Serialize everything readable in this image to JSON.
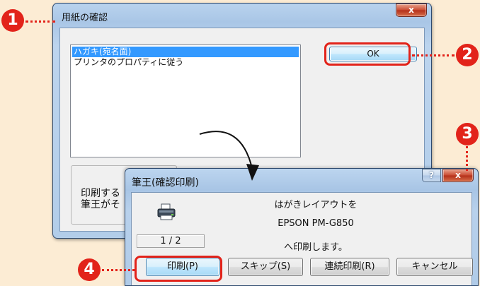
{
  "callouts": [
    "1",
    "2",
    "3",
    "4"
  ],
  "dialog_confirm_paper": {
    "title": "用紙の確認",
    "close_glyph": "x",
    "list_items": [
      "ハガキ(宛名面)",
      "プリンタのプロパティに従う"
    ],
    "selected_index": 0,
    "ok_label": "OK",
    "group_text_line1": "印刷する",
    "group_text_line2": "筆王がそ"
  },
  "dialog_confirm_print": {
    "title": "筆王(確認印刷)",
    "help_glyph": "?",
    "close_glyph": "x",
    "page_counter": "1 / 2",
    "message_line1": "はがきレイアウトを",
    "message_line2": "EPSON PM-G850",
    "message_line3": "へ印刷します。",
    "buttons": {
      "print": "印刷(P)",
      "skip": "スキップ(S)",
      "print_all": "連続印刷(R)",
      "cancel": "キャンセル"
    }
  },
  "colors": {
    "background": "#fcecd4",
    "callout_red": "#e2231a",
    "selection_blue": "#3399ff",
    "titlebar_blue": "#b1cbe9"
  },
  "icons": [
    "printer-icon",
    "close-icon",
    "help-icon",
    "curved-arrow-icon"
  ]
}
